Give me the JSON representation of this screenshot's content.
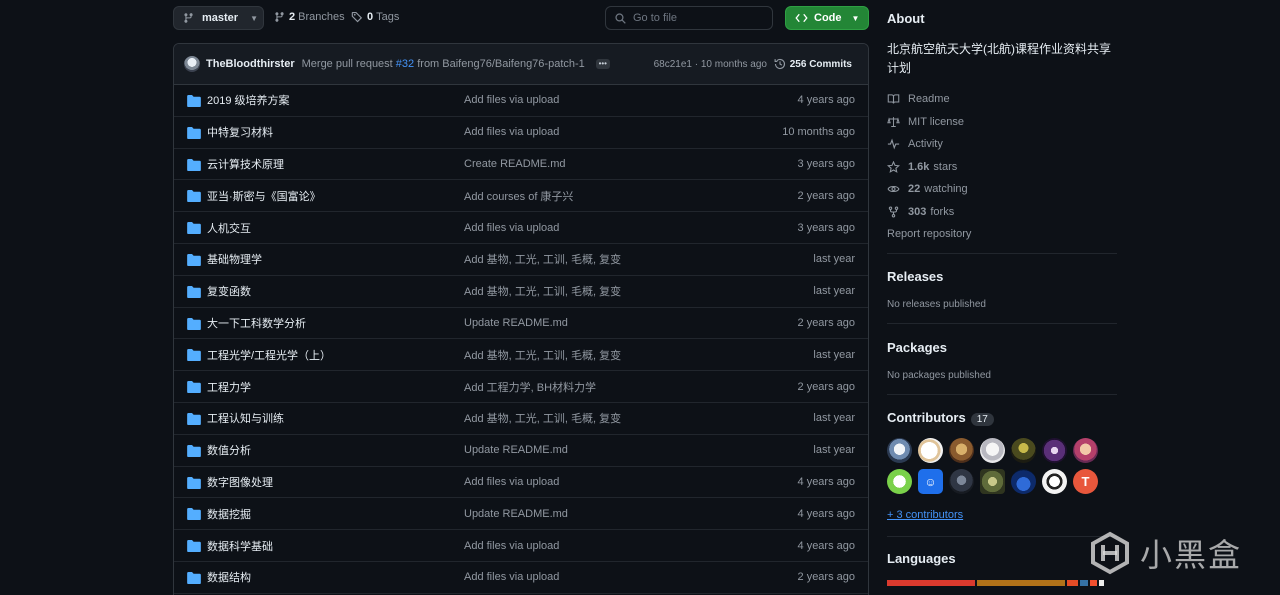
{
  "toolbar": {
    "branch": "master",
    "branches_count": "2",
    "branches_label": "Branches",
    "tags_count": "0",
    "tags_label": "Tags",
    "search_placeholder": "Go to file",
    "code_label": "Code"
  },
  "commit": {
    "author": "TheBloodthirster",
    "message_prefix": "Merge pull request",
    "pr": "#32",
    "message_suffix": "from Baifeng76/Baifeng76-patch-1",
    "meta": "68c21e1 · 10 months ago",
    "commits_count": "256 Commits"
  },
  "files": [
    {
      "name": "2019 级培养方案",
      "message": "Add files via upload",
      "age": "4 years ago"
    },
    {
      "name": "中特复习材料",
      "message": "Add files via upload",
      "age": "10 months ago"
    },
    {
      "name": "云计算技术原理",
      "message": "Create README.md",
      "age": "3 years ago"
    },
    {
      "name": "亚当·斯密与《国富论》",
      "message": "Add courses of 康子兴",
      "age": "2 years ago"
    },
    {
      "name": "人机交互",
      "message": "Add files via upload",
      "age": "3 years ago"
    },
    {
      "name": "基础物理学",
      "message": "Add 基物, 工光, 工训, 毛概, 复变",
      "age": "last year"
    },
    {
      "name": "复变函数",
      "message": "Add 基物, 工光, 工训, 毛概, 复变",
      "age": "last year"
    },
    {
      "name": "大一下工科数学分析",
      "message": "Update README.md",
      "age": "2 years ago"
    },
    {
      "name": "工程光学/工程光学（上）",
      "message": "Add 基物, 工光, 工训, 毛概, 复变",
      "age": "last year"
    },
    {
      "name": "工程力学",
      "message": "Add 工程力学, BH材料力学",
      "age": "2 years ago"
    },
    {
      "name": "工程认知与训练",
      "message": "Add 基物, 工光, 工训, 毛概, 复变",
      "age": "last year"
    },
    {
      "name": "数值分析",
      "message": "Update README.md",
      "age": "last year"
    },
    {
      "name": "数字图像处理",
      "message": "Add files via upload",
      "age": "4 years ago"
    },
    {
      "name": "数据挖掘",
      "message": "Update README.md",
      "age": "4 years ago"
    },
    {
      "name": "数据科学基础",
      "message": "Add files via upload",
      "age": "4 years ago"
    },
    {
      "name": "数据结构",
      "message": "Add files via upload",
      "age": "2 years ago"
    }
  ],
  "about": {
    "title": "About",
    "description": "北京航空航天大学(北航)课程作业资料共享计划",
    "readme": "Readme",
    "license": "MIT license",
    "activity": "Activity",
    "stars_count": "1.6k",
    "stars_label": "stars",
    "watching_count": "22",
    "watching_label": "watching",
    "forks_count": "303",
    "forks_label": "forks",
    "report": "Report repository"
  },
  "releases": {
    "title": "Releases",
    "empty": "No releases published"
  },
  "packages": {
    "title": "Packages",
    "empty": "No packages published"
  },
  "contributors": {
    "title": "Contributors",
    "count": "17",
    "more": "+ 3 contributors"
  },
  "languages": {
    "title": "Languages"
  },
  "watermark": {
    "text": "小黑盒"
  },
  "colors": {
    "accent_link": "#4493f8",
    "code_button": "#238636",
    "background": "#0d1117"
  },
  "icons": [
    "git-branch-icon",
    "tag-icon",
    "search-icon",
    "code-icon",
    "history-icon",
    "folder-icon",
    "book-icon",
    "law-icon",
    "pulse-icon",
    "star-icon",
    "eye-icon",
    "repo-forked-icon"
  ]
}
